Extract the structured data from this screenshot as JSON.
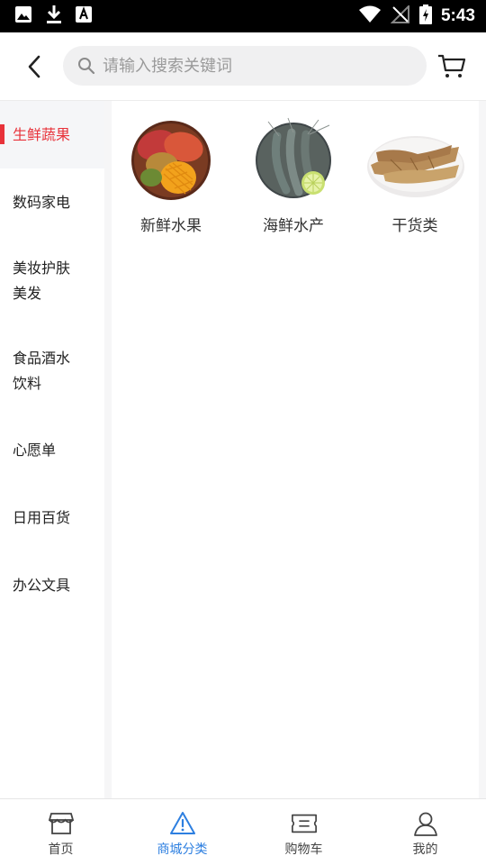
{
  "status_bar": {
    "time": "5:43"
  },
  "search": {
    "placeholder": "请输入搜索关键词"
  },
  "sidebar": {
    "items": [
      {
        "label": "生鲜蔬果",
        "active": true
      },
      {
        "label": "数码家电"
      },
      {
        "label": "美妆护肤美发"
      },
      {
        "label": "食品酒水饮料"
      },
      {
        "label": "心愿单"
      },
      {
        "label": "日用百货"
      },
      {
        "label": "办公文具"
      }
    ]
  },
  "categories": [
    {
      "label": "新鲜水果",
      "icon": "mango-image"
    },
    {
      "label": "海鲜水产",
      "icon": "shrimp-image"
    },
    {
      "label": "干货类",
      "icon": "dried-fish-image"
    }
  ],
  "tabbar": {
    "tabs": [
      {
        "label": "首页",
        "icon": "store-icon"
      },
      {
        "label": "商城分类",
        "icon": "triangle-warning-icon",
        "active": true
      },
      {
        "label": "购物车",
        "icon": "ticket-icon"
      },
      {
        "label": "我的",
        "icon": "user-icon"
      }
    ]
  },
  "colors": {
    "accent": "#e8323a",
    "tab_active": "#2d7fe0"
  }
}
